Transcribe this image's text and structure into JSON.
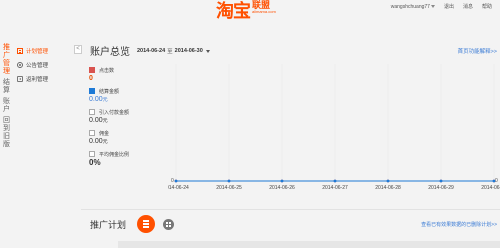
{
  "header": {
    "logo_main": "淘宝",
    "logo_sub": "联盟",
    "logo_domain": "alimama.com",
    "user": "wangshchuang77",
    "menu": [
      "退出",
      "消息",
      "帮助"
    ]
  },
  "vertical_tabs": [
    "推广管理",
    "结算",
    "账户",
    "回到旧版"
  ],
  "sidebar": {
    "items": [
      {
        "label": "计划管理",
        "icon": "plan-icon"
      },
      {
        "label": "公告管理",
        "icon": "gear-icon"
      },
      {
        "label": "返利管理",
        "icon": "back-icon"
      }
    ],
    "collapse_label": "<"
  },
  "overview": {
    "title": "账户总览",
    "date_from": "2014-06-24",
    "date_sep": "至",
    "date_to": "2014-06-30",
    "help_link": "首页功能解释>>"
  },
  "metrics": [
    {
      "label": "点击数",
      "value": "0",
      "checked": true,
      "color": "#d9534f"
    },
    {
      "label": "结算金额",
      "value": "0.00",
      "unit": "元",
      "checked": true,
      "color": "#1e7ad6"
    },
    {
      "label": "引入付款金额",
      "value": "0.00",
      "unit": "元",
      "checked": false
    },
    {
      "label": "佣金",
      "value": "0.00",
      "unit": "元",
      "checked": false
    },
    {
      "label": "平均佣金比例",
      "value": "0%",
      "checked": false
    }
  ],
  "chart_data": {
    "type": "line",
    "x": [
      "2014-06-24",
      "2014-06-25",
      "2014-06-26",
      "2014-06-27",
      "2014-06-28",
      "2014-06-29",
      "2014-06-30"
    ],
    "series": [
      {
        "name": "点击数",
        "values": [
          0,
          0,
          0,
          0,
          0,
          0,
          0
        ],
        "color": "#d9534f"
      },
      {
        "name": "结算金额",
        "values": [
          0,
          0,
          0,
          0,
          0,
          0,
          0
        ],
        "color": "#1e7ad6"
      }
    ],
    "left_axis_label": "0",
    "right_axis_label": "0",
    "grid": true
  },
  "plan": {
    "title": "推广计划",
    "report_link": "查看已有效果数据的已删除计划>>"
  }
}
